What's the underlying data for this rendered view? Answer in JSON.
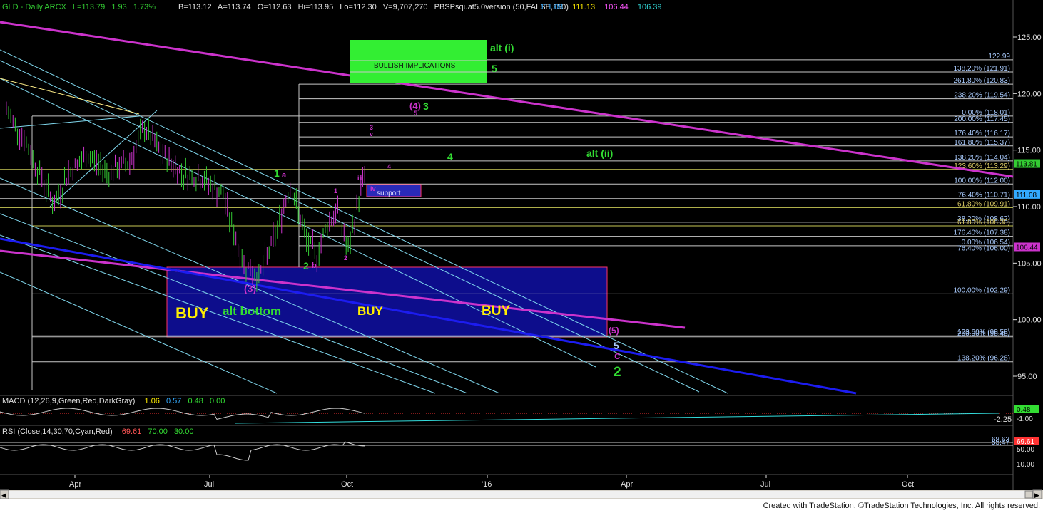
{
  "header": {
    "symbol": "GLD - Daily  ARCX",
    "last": "L=113.79",
    "change": "1.93",
    "change_pct": "1.73%",
    "bid": "B=113.12",
    "ask": "A=113.74",
    "open": "O=112.63",
    "hi": "Hi=113.95",
    "lo": "Lo=112.30",
    "volume": "V=9,707,270",
    "study": "PBSPsquat5.0version (50,FALSE,150)",
    "study_values": [
      "111.08",
      "111.13",
      "106.44",
      "106.39"
    ]
  },
  "colors": {
    "background": "#000000",
    "price_up": "#33cc33",
    "price_down": "#cc33cc",
    "trendline_magenta": "#cc33cc",
    "trendline_blue": "#1c1cf0",
    "channel_cyan": "#80d8ee",
    "fib_line": "#c8c8c8",
    "buy_zone_fill": "#0d0d8c",
    "buy_zone_border": "#ff3366",
    "bullish_box": "#33ee33",
    "buy_text": "#ffee00",
    "wave_green": "#33dd33",
    "wave_magenta": "#cc33cc"
  },
  "chart_data": {
    "type": "candlestick",
    "title": "GLD - Daily",
    "x_ticks": [
      "Apr",
      "Jul",
      "Oct",
      "'16",
      "Apr",
      "Jul",
      "Oct"
    ],
    "ylim": [
      93,
      127
    ],
    "y_ticks": [
      95.0,
      100.0,
      105.0,
      110.0,
      115.0,
      120.0,
      125.0
    ],
    "price_badges": [
      {
        "value": "113.81",
        "price": 113.81,
        "color": "#33cc33"
      },
      {
        "value": "111.08",
        "price": 111.08,
        "color": "#33aaff"
      },
      {
        "value": "106.44",
        "price": 106.44,
        "color": "#cc33cc"
      }
    ],
    "price_path": [
      {
        "d": "2015-02-06",
        "c": 118.5
      },
      {
        "d": "2015-02-20",
        "c": 116.0
      },
      {
        "d": "2015-03-06",
        "c": 112.5
      },
      {
        "d": "2015-03-16",
        "c": 110.2
      },
      {
        "d": "2015-03-27",
        "c": 113.0
      },
      {
        "d": "2015-04-10",
        "c": 114.5
      },
      {
        "d": "2015-04-24",
        "c": 113.0
      },
      {
        "d": "2015-05-08",
        "c": 114.0
      },
      {
        "d": "2015-05-18",
        "c": 117.0
      },
      {
        "d": "2015-05-29",
        "c": 114.7
      },
      {
        "d": "2015-06-12",
        "c": 113.0
      },
      {
        "d": "2015-06-26",
        "c": 112.5
      },
      {
        "d": "2015-07-10",
        "c": 111.0
      },
      {
        "d": "2015-07-20",
        "c": 106.5
      },
      {
        "d": "2015-07-24",
        "c": 104.9
      },
      {
        "d": "2015-08-03",
        "c": 103.8
      },
      {
        "d": "2015-08-14",
        "c": 107.5
      },
      {
        "d": "2015-08-24",
        "c": 111.9
      },
      {
        "d": "2015-09-04",
        "c": 107.0
      },
      {
        "d": "2015-09-11",
        "c": 105.7
      },
      {
        "d": "2015-09-18",
        "c": 108.5
      },
      {
        "d": "2015-09-25",
        "c": 109.7
      },
      {
        "d": "2015-10-02",
        "c": 106.0
      },
      {
        "d": "2015-10-09",
        "c": 110.8
      },
      {
        "d": "2015-10-14",
        "c": 113.8
      }
    ],
    "fib_levels": [
      {
        "label": "122.99",
        "price": 122.99
      },
      {
        "label": "138.20% (121.91)",
        "price": 121.91
      },
      {
        "label": "261.80% (120.83)",
        "price": 120.83
      },
      {
        "label": "238.20% (119.54)",
        "price": 119.54
      },
      {
        "label": "0.00% (118.01)",
        "price": 118.01
      },
      {
        "label": "200.00% (117.45)",
        "price": 117.45
      },
      {
        "label": "176.40% (116.17)",
        "price": 116.17
      },
      {
        "label": "161.80% (115.37)",
        "price": 115.37
      },
      {
        "label": "138.20% (114.04)",
        "price": 114.04
      },
      {
        "label": "123.60% (113.29)",
        "price": 113.29
      },
      {
        "label": "100.00% (112.00)",
        "price": 112.0
      },
      {
        "label": "76.40% (110.71)",
        "price": 110.71
      },
      {
        "label": "61.80% (109.91)",
        "price": 109.91
      },
      {
        "label": "38.20% (108.62)",
        "price": 108.62
      },
      {
        "label": "61.80% (108.30)",
        "price": 108.3
      },
      {
        "label": "176.40% (107.38)",
        "price": 107.38
      },
      {
        "label": "0.00% (106.54)",
        "price": 106.54
      },
      {
        "label": "76.40% (106.00)",
        "price": 106.0
      },
      {
        "label": "100.00% (102.29)",
        "price": 102.29
      },
      {
        "label": "123.60% (98.58)",
        "price": 98.58
      },
      {
        "label": "200.00% (98.48)",
        "price": 98.48
      },
      {
        "label": "138.20% (96.28)",
        "price": 96.28
      }
    ],
    "annotations": [
      {
        "text": "BULLISH IMPLICATIONS",
        "kind": "box"
      },
      {
        "text": "alt (i)",
        "color": "#33dd33"
      },
      {
        "text": "5",
        "color": "#33dd33"
      },
      {
        "text": "(4)",
        "color": "#cc33cc"
      },
      {
        "text": "5",
        "color": "#cc33cc"
      },
      {
        "text": "3",
        "color": "#33dd33"
      },
      {
        "text": "3",
        "color": "#cc33cc"
      },
      {
        "text": "v",
        "color": "#cc33cc"
      },
      {
        "text": "4",
        "color": "#33dd33"
      },
      {
        "text": "alt (ii)",
        "color": "#33dd33"
      },
      {
        "text": "4",
        "color": "#cc33cc"
      },
      {
        "text": "1",
        "color": "#33dd33"
      },
      {
        "text": "a",
        "color": "#cc33cc"
      },
      {
        "text": "iii",
        "color": "#cc33cc"
      },
      {
        "text": "iv",
        "color": "#cc33cc"
      },
      {
        "text": "support",
        "kind": "box"
      },
      {
        "text": "1",
        "color": "#cc33cc"
      },
      {
        "text": "2",
        "color": "#33dd33"
      },
      {
        "text": "b",
        "color": "#cc33cc"
      },
      {
        "text": "2",
        "color": "#cc33cc"
      },
      {
        "text": "(3)",
        "color": "#cc33cc"
      },
      {
        "text": "BUY",
        "color": "#ffee00"
      },
      {
        "text": "alt bottom",
        "color": "#33dd33"
      },
      {
        "text": "BUY",
        "color": "#ffee00"
      },
      {
        "text": "BUY",
        "color": "#ffee00"
      },
      {
        "text": "(5)",
        "color": "#cc33cc"
      },
      {
        "text": "5",
        "color": "#aaccff"
      },
      {
        "text": "c",
        "color": "#cc33cc"
      },
      {
        "text": "2",
        "color": "#33dd33"
      }
    ]
  },
  "macd": {
    "label": "MACD (12,26,9,Green,Red,DarkGray)",
    "values": [
      "1.06",
      "0.57",
      "0.48",
      "0.00"
    ],
    "badges": [
      "0.48",
      "-1.00"
    ],
    "level": "-2.25"
  },
  "rsi": {
    "label": "RSI (Close,14,30,70,Cyan,Red)",
    "values": [
      "69.61",
      "70.00",
      "30.00"
    ],
    "levels": [
      "68.63",
      "55.47"
    ],
    "badges": [
      "69.61",
      "50.00"
    ],
    "axis": "10.00"
  },
  "footer": {
    "credit": "Created with TradeStation. ©TradeStation Technologies, Inc. All rights reserved."
  }
}
